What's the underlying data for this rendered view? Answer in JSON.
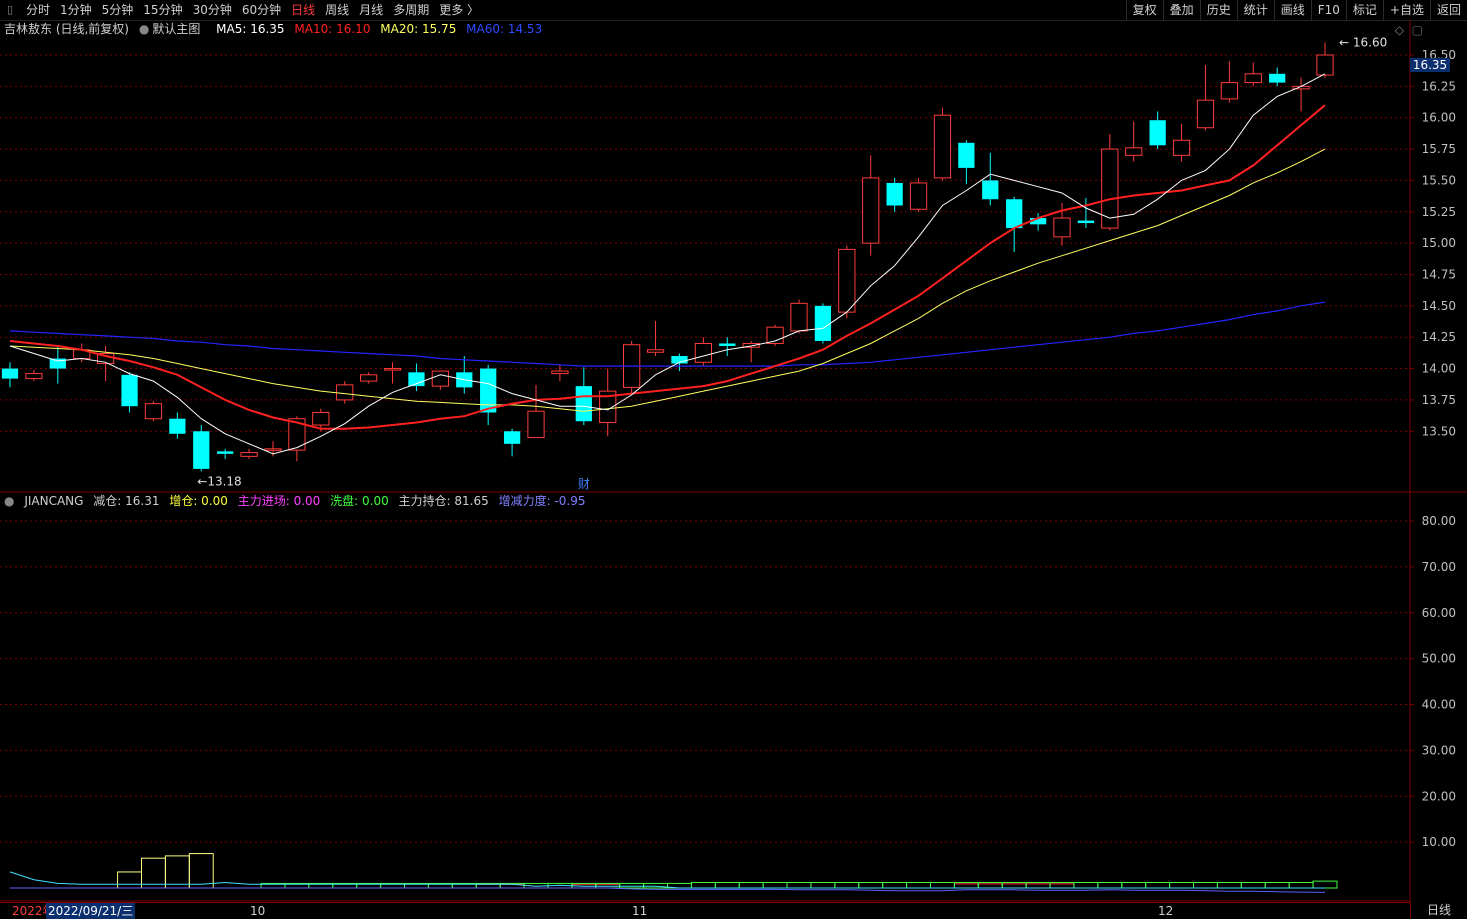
{
  "toolbar": {
    "left_items": [
      "分时",
      "1分钟",
      "5分钟",
      "15分钟",
      "30分钟",
      "60分钟",
      "日线",
      "周线",
      "月线",
      "多周期",
      "更多 〉"
    ],
    "active_index": 6,
    "right_items": [
      "复权",
      "叠加",
      "历史",
      "统计",
      "画线",
      "F10",
      "标记",
      "+自选",
      "返回"
    ]
  },
  "info": {
    "stock": "吉林敖东 (日线,前复权)",
    "main_chart": "默认主图",
    "ma5": "MA5: 16.35",
    "ma10": "MA10: 16.10",
    "ma20": "MA20: 15.75",
    "ma60": "MA60: 14.53"
  },
  "colors": {
    "up": "#ff3c3c",
    "down": "#00ffff",
    "ma5": "#ffffff",
    "ma10": "#ff2020",
    "ma20": "#ffff60",
    "ma60": "#2424ff",
    "grid": "#7a0000",
    "bg": "#000000"
  },
  "price_axis": [
    "16.50",
    "16.25",
    "16.00",
    "15.75",
    "15.50",
    "15.25",
    "15.00",
    "14.75",
    "14.50",
    "14.25",
    "14.00",
    "13.75",
    "13.50"
  ],
  "current_price": "16.35",
  "high_label": "16.60",
  "low_label": "13.18",
  "event_marker": "财",
  "sub": {
    "name": "JIANCANG",
    "jiancang": "减仓: 16.31",
    "zengcang": "增仓: 0.00",
    "zhuli_jinchang": "主力进场: 0.00",
    "xipan": "洗盘: 0.00",
    "zhuli_chicang": "主力持仓: 81.65",
    "zengjian": "增减力度: -0.95"
  },
  "sub_axis": [
    "80.00",
    "70.00",
    "60.00",
    "50.00",
    "40.00",
    "30.00",
    "20.00",
    "10.00"
  ],
  "dates": {
    "year": "2022年",
    "cursor": "2022/09/21/三",
    "m10": "10",
    "m11": "11",
    "m12": "12"
  },
  "axis_caption": "日线",
  "chart_data": {
    "type": "candlestick",
    "candles": [
      [
        14.0,
        13.92,
        13.85,
        14.05
      ],
      [
        13.92,
        13.96,
        13.9,
        13.99
      ],
      [
        14.08,
        14.0,
        13.88,
        14.18
      ],
      [
        14.08,
        14.15,
        14.05,
        14.2
      ],
      [
        14.04,
        14.12,
        13.9,
        14.18
      ],
      [
        13.95,
        13.7,
        13.65,
        13.97
      ],
      [
        13.6,
        13.72,
        13.58,
        13.74
      ],
      [
        13.6,
        13.48,
        13.44,
        13.65
      ],
      [
        13.5,
        13.2,
        13.18,
        13.55
      ],
      [
        13.34,
        13.32,
        13.28,
        13.36
      ],
      [
        13.3,
        13.33,
        13.28,
        13.36
      ],
      [
        13.35,
        13.36,
        13.3,
        13.42
      ],
      [
        13.35,
        13.6,
        13.26,
        13.62
      ],
      [
        13.55,
        13.65,
        13.5,
        13.68
      ],
      [
        13.75,
        13.87,
        13.72,
        13.9
      ],
      [
        13.9,
        13.95,
        13.88,
        13.97
      ],
      [
        14.0,
        14.0,
        13.88,
        14.05
      ],
      [
        13.97,
        13.86,
        13.82,
        14.04
      ],
      [
        13.86,
        13.98,
        13.83,
        13.98
      ],
      [
        13.97,
        13.85,
        13.8,
        14.1
      ],
      [
        14.0,
        13.65,
        13.55,
        14.03
      ],
      [
        13.5,
        13.4,
        13.3,
        13.52
      ],
      [
        13.45,
        13.66,
        13.45,
        13.87
      ],
      [
        13.96,
        13.98,
        13.9,
        14.03
      ],
      [
        13.86,
        13.58,
        13.55,
        14.01
      ],
      [
        13.57,
        13.82,
        13.46,
        14.0
      ],
      [
        13.85,
        14.19,
        13.8,
        14.22
      ],
      [
        14.13,
        14.15,
        14.1,
        14.38
      ],
      [
        14.1,
        14.04,
        13.98,
        14.12
      ],
      [
        14.05,
        14.2,
        14.02,
        14.25
      ],
      [
        14.2,
        14.18,
        14.1,
        14.25
      ],
      [
        14.17,
        14.2,
        14.05,
        14.22
      ],
      [
        14.2,
        14.33,
        14.18,
        14.35
      ],
      [
        14.3,
        14.52,
        14.28,
        14.55
      ],
      [
        14.5,
        14.22,
        14.2,
        14.52
      ],
      [
        14.45,
        14.95,
        14.4,
        14.98
      ],
      [
        15.0,
        15.52,
        14.9,
        15.7
      ],
      [
        15.48,
        15.3,
        15.25,
        15.52
      ],
      [
        15.27,
        15.48,
        15.25,
        15.52
      ],
      [
        15.52,
        16.02,
        15.5,
        16.08
      ],
      [
        15.8,
        15.6,
        15.47,
        15.82
      ],
      [
        15.5,
        15.35,
        15.3,
        15.72
      ],
      [
        15.35,
        15.12,
        14.93,
        15.37
      ],
      [
        15.2,
        15.15,
        15.1,
        15.24
      ],
      [
        15.05,
        15.2,
        14.98,
        15.32
      ],
      [
        15.18,
        15.16,
        15.12,
        15.36
      ],
      [
        15.12,
        15.75,
        15.1,
        15.87
      ],
      [
        15.7,
        15.76,
        15.65,
        15.97
      ],
      [
        15.98,
        15.78,
        15.75,
        16.05
      ],
      [
        15.7,
        15.82,
        15.65,
        15.95
      ],
      [
        15.92,
        16.14,
        15.9,
        16.42
      ],
      [
        16.15,
        16.28,
        16.12,
        16.45
      ],
      [
        16.28,
        16.35,
        16.25,
        16.44
      ],
      [
        16.35,
        16.28,
        16.25,
        16.4
      ],
      [
        16.23,
        16.25,
        16.05,
        16.32
      ],
      [
        16.34,
        16.5,
        16.32,
        16.6
      ]
    ],
    "ma5": [
      14.18,
      14.12,
      14.06,
      14.08,
      14.05,
      13.96,
      13.9,
      13.77,
      13.6,
      13.48,
      13.4,
      13.32,
      13.37,
      13.46,
      13.56,
      13.7,
      13.81,
      13.88,
      13.95,
      13.91,
      13.88,
      13.8,
      13.75,
      13.7,
      13.7,
      13.67,
      13.79,
      13.95,
      14.05,
      14.1,
      14.15,
      14.18,
      14.22,
      14.3,
      14.32,
      14.45,
      14.66,
      14.82,
      15.05,
      15.3,
      15.42,
      15.55,
      15.5,
      15.45,
      15.4,
      15.28,
      15.2,
      15.23,
      15.35,
      15.5,
      15.58,
      15.75,
      16.02,
      16.17,
      16.25,
      16.35
    ],
    "ma10": [
      14.22,
      14.2,
      14.18,
      14.15,
      14.1,
      14.06,
      14.01,
      13.95,
      13.85,
      13.75,
      13.67,
      13.61,
      13.57,
      13.52,
      13.52,
      13.53,
      13.55,
      13.57,
      13.6,
      13.62,
      13.68,
      13.72,
      13.75,
      13.76,
      13.78,
      13.78,
      13.8,
      13.82,
      13.84,
      13.86,
      13.9,
      13.96,
      14.02,
      14.08,
      14.15,
      14.26,
      14.36,
      14.47,
      14.58,
      14.72,
      14.86,
      15.0,
      15.12,
      15.2,
      15.26,
      15.3,
      15.35,
      15.38,
      15.4,
      15.42,
      15.46,
      15.5,
      15.62,
      15.78,
      15.94,
      16.1
    ],
    "ma20": [
      14.18,
      14.17,
      14.16,
      14.15,
      14.13,
      14.11,
      14.08,
      14.04,
      14.0,
      13.96,
      13.92,
      13.88,
      13.85,
      13.82,
      13.8,
      13.78,
      13.76,
      13.74,
      13.73,
      13.72,
      13.71,
      13.71,
      13.7,
      13.68,
      13.66,
      13.68,
      13.7,
      13.74,
      13.78,
      13.82,
      13.86,
      13.9,
      13.94,
      13.98,
      14.04,
      14.12,
      14.2,
      14.3,
      14.4,
      14.52,
      14.62,
      14.7,
      14.77,
      14.84,
      14.9,
      14.96,
      15.02,
      15.08,
      15.14,
      15.22,
      15.3,
      15.38,
      15.48,
      15.56,
      15.65,
      15.75
    ],
    "ma60": [
      14.3,
      14.29,
      14.28,
      14.27,
      14.26,
      14.25,
      14.24,
      14.22,
      14.21,
      14.19,
      14.18,
      14.16,
      14.15,
      14.14,
      14.13,
      14.12,
      14.11,
      14.1,
      14.08,
      14.07,
      14.06,
      14.05,
      14.04,
      14.03,
      14.02,
      14.02,
      14.02,
      14.02,
      14.02,
      14.02,
      14.02,
      14.02,
      14.02,
      14.03,
      14.03,
      14.04,
      14.05,
      14.07,
      14.09,
      14.11,
      14.13,
      14.15,
      14.17,
      14.19,
      14.21,
      14.23,
      14.25,
      14.28,
      14.3,
      14.33,
      14.36,
      14.39,
      14.43,
      14.46,
      14.5,
      14.53
    ],
    "sub_yellow": [
      0,
      0,
      0,
      0,
      0,
      3.5,
      6.5,
      7,
      7.5,
      0,
      0,
      0,
      0,
      0,
      0,
      0,
      0,
      0,
      0,
      0,
      0,
      0,
      0,
      0,
      0,
      0,
      0,
      0,
      0,
      0,
      0,
      0,
      0,
      0,
      0,
      0,
      0,
      0,
      0,
      0,
      0,
      0,
      0,
      0,
      0,
      0,
      0,
      0,
      0,
      0,
      0,
      0,
      0,
      0,
      0,
      0
    ],
    "sub_cyan": [
      3.5,
      1.8,
      1,
      0.8,
      0.8,
      0.8,
      0.8,
      0.8,
      0.8,
      1.2,
      0.8,
      0.8,
      0.8,
      0.8,
      0.8,
      0.8,
      0.8,
      0.8,
      0.8,
      0.8,
      0.8,
      0.8,
      0.4,
      0.6,
      0.4,
      0.4,
      0.4,
      0.4,
      0,
      0,
      0,
      0,
      0,
      0,
      0,
      0,
      0,
      0,
      0,
      0,
      0,
      0,
      0,
      0,
      0,
      0,
      0,
      0,
      0,
      0,
      0,
      0,
      0,
      0,
      0,
      0
    ],
    "sub_green": [
      0,
      0,
      0,
      0,
      0,
      0,
      0,
      0,
      0,
      0,
      0,
      1,
      1,
      1,
      1,
      1,
      1,
      1,
      1,
      1,
      1,
      1,
      1,
      1,
      1,
      1,
      1,
      1,
      1,
      1.2,
      1.2,
      1.2,
      1.2,
      1.2,
      1.2,
      1.2,
      1.2,
      1.2,
      1.2,
      1.2,
      1.2,
      1.2,
      1.2,
      1.2,
      1.2,
      1.2,
      1.2,
      1.2,
      1.2,
      1.2,
      1.2,
      1.2,
      1.2,
      1.2,
      1.2,
      1.5
    ],
    "sub_red": [
      0,
      0,
      0,
      0,
      0,
      0,
      0,
      0,
      0,
      0,
      0,
      0,
      0,
      0,
      0,
      0,
      0,
      0,
      0,
      0,
      0.8,
      0.8,
      0,
      0,
      0.8,
      0.8,
      0,
      0,
      0,
      0,
      0,
      0,
      0,
      0,
      0,
      0,
      0,
      0,
      0,
      0,
      0.9,
      0.9,
      0.9,
      0.9,
      0.9,
      0,
      0,
      0,
      0,
      0,
      0,
      0,
      0,
      0,
      0,
      0
    ],
    "sub_blue": [
      0,
      0,
      0,
      0,
      0,
      0,
      0,
      0,
      0,
      0,
      0,
      0,
      0,
      0,
      0,
      0,
      0,
      0,
      0,
      0,
      0,
      0,
      0,
      0,
      0,
      0,
      -0.2,
      -0.3,
      -0.3,
      -0.3,
      -0.3,
      -0.3,
      -0.3,
      -0.4,
      -0.4,
      -0.4,
      -0.5,
      -0.6,
      -0.6,
      -0.6,
      -0.4,
      -0.4,
      -0.4,
      -0.5,
      -0.5,
      -0.5,
      -0.4,
      -0.5,
      -0.5,
      -0.5,
      -0.6,
      -0.7,
      -0.7,
      -0.8,
      -0.9,
      -0.95
    ],
    "ylim_price": [
      13.0,
      16.7
    ],
    "ylim_sub": [
      0,
      88
    ]
  }
}
